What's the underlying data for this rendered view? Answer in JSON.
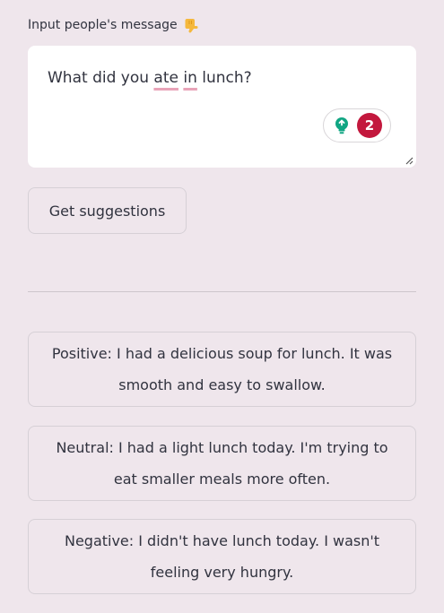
{
  "input_label": "Input people's message",
  "input_label_icon": "pointing-down-hand-icon",
  "message": {
    "before": "What did you ",
    "error1": "ate",
    "between": " ",
    "error2": "in",
    "after": " lunch?"
  },
  "grammar_badge": {
    "icon": "lightbulb-icon",
    "count": "2",
    "accent_color": "#11a683",
    "count_color": "#c3183d"
  },
  "get_suggestions_label": "Get suggestions",
  "suggestions": [
    "Positive: I had a delicious soup for lunch. It was smooth and easy to swallow.",
    "Neutral: I had a light lunch today. I'm trying to eat smaller meals more often.",
    "Negative: I didn't have lunch today. I wasn't feeling very hungry."
  ]
}
